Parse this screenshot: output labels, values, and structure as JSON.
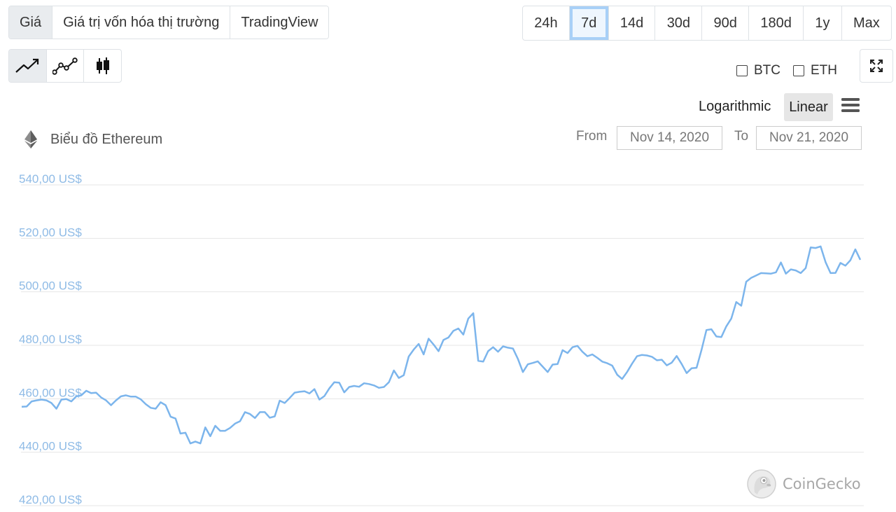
{
  "tabs": [
    {
      "label": "Giá",
      "active": true
    },
    {
      "label": "Giá trị vốn hóa thị trường",
      "active": false
    },
    {
      "label": "TradingView",
      "active": false
    }
  ],
  "ranges": [
    {
      "label": "24h",
      "active": false
    },
    {
      "label": "7d",
      "active": true
    },
    {
      "label": "14d",
      "active": false
    },
    {
      "label": "30d",
      "active": false
    },
    {
      "label": "90d",
      "active": false
    },
    {
      "label": "180d",
      "active": false
    },
    {
      "label": "1y",
      "active": false
    },
    {
      "label": "Max",
      "active": false
    }
  ],
  "chart_types": [
    {
      "icon": "line-chart-icon",
      "active": true
    },
    {
      "icon": "line-markers-chart-icon",
      "active": false
    },
    {
      "icon": "candlestick-chart-icon",
      "active": false
    }
  ],
  "compare": {
    "btc_label": "BTC",
    "eth_label": "ETH",
    "btc_checked": false,
    "eth_checked": false
  },
  "scale": {
    "log_label": "Logarithmic",
    "linear_label": "Linear",
    "selected": "Linear"
  },
  "chart_title": "Biểu đồ Ethereum",
  "date_range": {
    "from_label": "From",
    "from_value": "Nov 14, 2020",
    "to_label": "To",
    "to_value": "Nov 21, 2020"
  },
  "credits": "CoinGecko",
  "colors": {
    "line": "#7cb5ec",
    "axis_label": "#8fbbe6",
    "grid": "#e6e6e6",
    "active_range_border": "#a8d0f7"
  },
  "chart_data": {
    "type": "line",
    "title": "Biểu đồ Ethereum",
    "ylabel": "",
    "xlabel": "",
    "ylim": [
      420,
      540
    ],
    "y_ticks": [
      540,
      520,
      500,
      480,
      460,
      440,
      420
    ],
    "y_tick_labels": [
      "540,00 US$",
      "520,00 US$",
      "500,00 US$",
      "480,00 US$",
      "460,00 US$",
      "440,00 US$",
      "420,00 US$"
    ],
    "x_range": [
      "Nov 14, 2020",
      "Nov 21, 2020"
    ],
    "grid": true,
    "series": [
      {
        "values": [
          457.0,
          457.1,
          459.0,
          459.4,
          459.7,
          459.4,
          458.4,
          456.3,
          459.7,
          459.9,
          459.0,
          460.9,
          461.3,
          463.0,
          462.1,
          462.3,
          460.5,
          459.4,
          457.6,
          459.4,
          460.9,
          461.3,
          460.8,
          460.8,
          459.8,
          458.0,
          456.6,
          456.3,
          458.7,
          457.6,
          453.3,
          452.6,
          447.0,
          447.3,
          443.3,
          444.0,
          443.3,
          449.3,
          446.0,
          449.9,
          448.0,
          448.0,
          449.1,
          450.7,
          451.6,
          455.0,
          454.3,
          452.8,
          455.0,
          455.0,
          452.9,
          453.4,
          459.3,
          458.4,
          460.3,
          462.3,
          462.6,
          462.8,
          462.0,
          463.6,
          459.7,
          461.0,
          463.9,
          466.2,
          466.0,
          462.4,
          464.4,
          464.8,
          464.5,
          465.8,
          465.5,
          465.0,
          464.1,
          464.4,
          466.2,
          470.6,
          467.8,
          468.8,
          475.8,
          478.4,
          480.5,
          476.6,
          482.5,
          480.3,
          477.8,
          482.0,
          482.9,
          485.4,
          486.3,
          484.0,
          490.0,
          492.0,
          474.2,
          473.9,
          477.8,
          479.3,
          477.6,
          479.6,
          479.1,
          478.8,
          474.9,
          470.0,
          472.9,
          473.4,
          474.0,
          472.0,
          470.0,
          472.8,
          473.0,
          478.2,
          477.1,
          479.3,
          479.8,
          477.6,
          475.9,
          476.6,
          475.3,
          473.9,
          473.3,
          472.4,
          469.0,
          467.4,
          470.0,
          473.1,
          475.9,
          476.4,
          476.2,
          475.7,
          474.4,
          474.6,
          472.5,
          473.5,
          476.0,
          473.0,
          469.6,
          471.4,
          471.6,
          478.3,
          485.7,
          486.0,
          483.3,
          483.1,
          487.1,
          490.0,
          496.2,
          494.8,
          503.8,
          505.2,
          506.1,
          507.0,
          506.9,
          506.8,
          507.3,
          511.0,
          506.8,
          508.4,
          508.0,
          507.0,
          508.9,
          516.6,
          516.4,
          517.0,
          511.1,
          507.0,
          507.1,
          510.8,
          509.8,
          511.8,
          515.9,
          512.0
        ]
      }
    ]
  }
}
